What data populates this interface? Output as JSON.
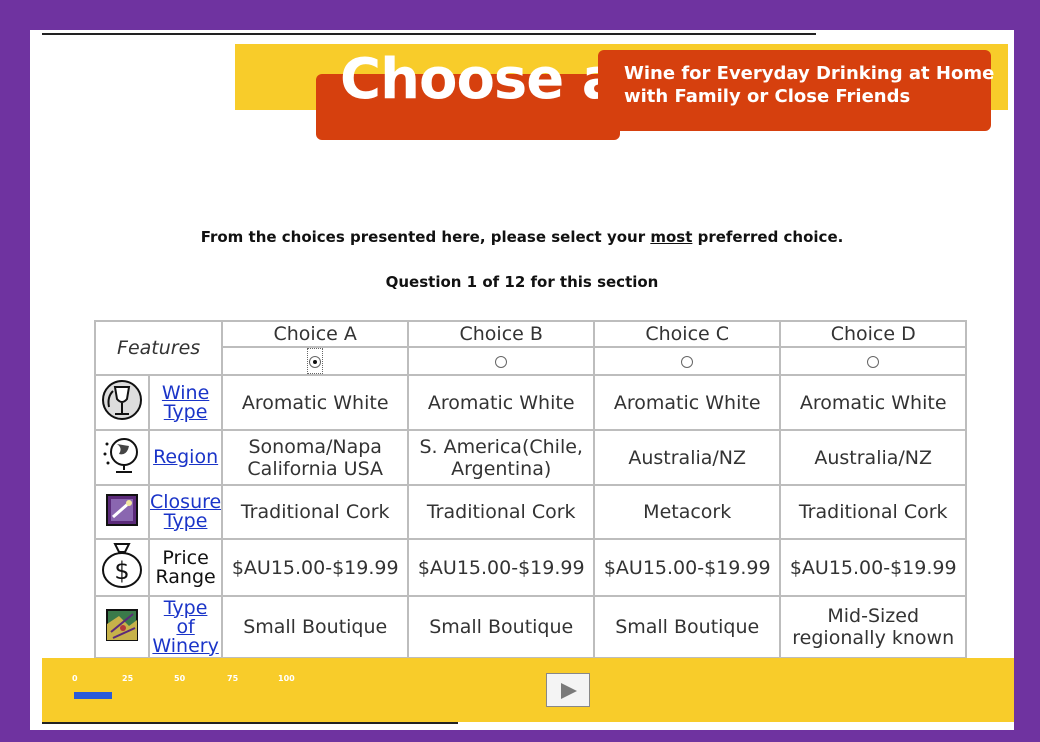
{
  "banner": {
    "title": "Choose a",
    "subtitle_line1": "Wine for Everyday Drinking at Home",
    "subtitle_line2": "with Family or Close Friends"
  },
  "instruction": {
    "before": "From the choices presented here, please select your ",
    "emphasis": "most",
    "after": " preferred choice."
  },
  "question_text": "Question 1 of 12 for this section",
  "table": {
    "features_header": "Features",
    "choices": [
      "Choice A",
      "Choice B",
      "Choice C",
      "Choice D"
    ],
    "selected_choice": "Choice A",
    "rows": [
      {
        "icon": "wine-glass-icon",
        "label_lines": [
          "Wine",
          "Type"
        ],
        "is_link": true,
        "values": [
          "Aromatic White",
          "Aromatic White",
          "Aromatic White",
          "Aromatic White"
        ]
      },
      {
        "icon": "globe-icon",
        "label_lines": [
          "Region"
        ],
        "is_link": true,
        "values": [
          "Sonoma/Napa California USA",
          "S. America(Chile, Argentina)",
          "Australia/NZ",
          "Australia/NZ"
        ]
      },
      {
        "icon": "cork-icon",
        "label_lines": [
          "Closure",
          "Type"
        ],
        "is_link": true,
        "values": [
          "Traditional Cork",
          "Traditional Cork",
          "Metacork",
          "Traditional Cork"
        ]
      },
      {
        "icon": "money-bag-icon",
        "label_lines": [
          "Price",
          "Range"
        ],
        "is_link": false,
        "values": [
          "$AU15.00-$19.99",
          "$AU15.00-$19.99",
          "$AU15.00-$19.99",
          "$AU15.00-$19.99"
        ]
      },
      {
        "icon": "vineyard-map-icon",
        "label_lines": [
          "Type",
          "of",
          "Winery"
        ],
        "is_link": true,
        "values": [
          "Small Boutique",
          "Small Boutique",
          "Small Boutique",
          "Mid-Sized regionally known"
        ]
      }
    ]
  },
  "progress": {
    "tick_labels": [
      "0",
      "25",
      "50",
      "75",
      "100"
    ],
    "percent": 8
  },
  "colors": {
    "frame": "#6f33a0",
    "banner_yellow": "#f8cc2a",
    "banner_red": "#d6400e",
    "link": "#1a34c8",
    "progress_fill": "#2a5bd8"
  }
}
